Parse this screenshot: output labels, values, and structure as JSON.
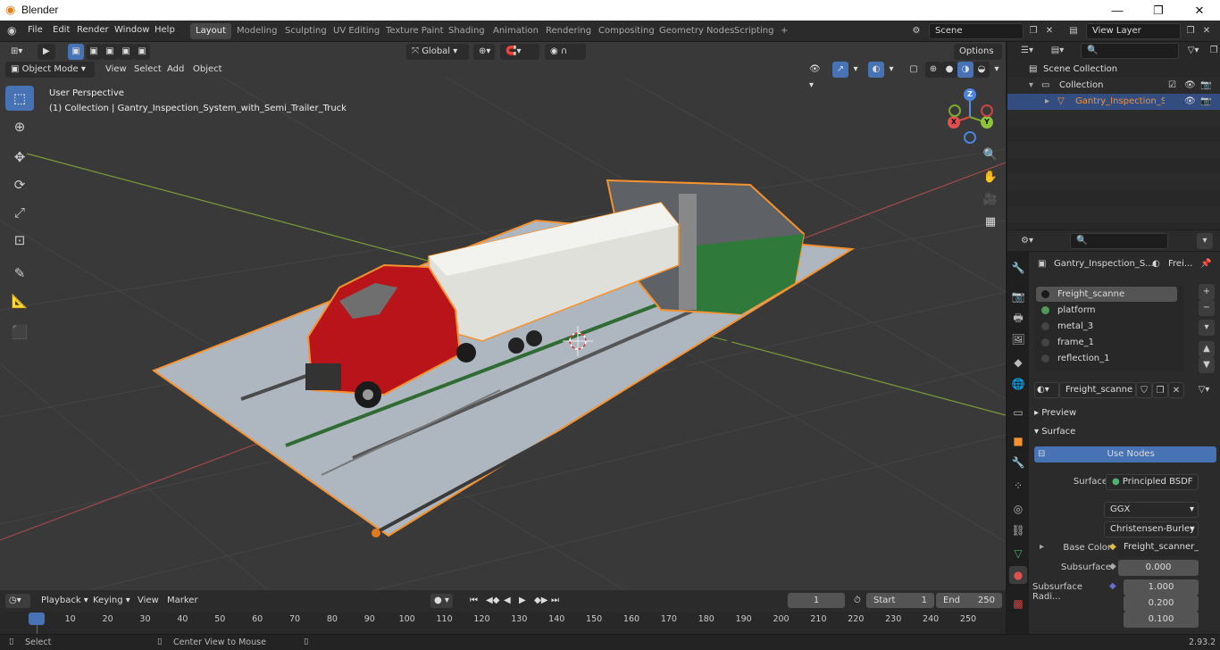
{
  "window": {
    "title": "Blender",
    "minimize": "—",
    "maximize": "❐",
    "close": "✕"
  },
  "menus": [
    "File",
    "Edit",
    "Render",
    "Window",
    "Help"
  ],
  "workspaces": [
    "Layout",
    "Modeling",
    "Sculpting",
    "UV Editing",
    "Texture Paint",
    "Shading",
    "Animation",
    "Rendering",
    "Compositing",
    "Geometry Nodes",
    "Scripting"
  ],
  "active_workspace": "Layout",
  "scene": {
    "name": "Scene",
    "view_layer": "View Layer"
  },
  "viewport": {
    "mode": "Object Mode",
    "menus": [
      "View",
      "Select",
      "Add",
      "Object"
    ],
    "orientation": "Global",
    "options": "Options",
    "perspective_label": "User Perspective",
    "collection_label": "(1) Collection | Gantry_Inspection_System_with_Semi_Trailer_Truck",
    "axes": {
      "x": "X",
      "y": "Y",
      "z": "Z"
    }
  },
  "outliner": {
    "root": "Scene Collection",
    "collection": "Collection",
    "object": "Gantry_Inspection_Syster"
  },
  "properties": {
    "object_name": "Gantry_Inspection_S...",
    "material_short": "Frei...",
    "slots": [
      {
        "name": "Freight_scanne",
        "color": "#1a1a1a"
      },
      {
        "name": "platform",
        "color": "#4f9a58"
      },
      {
        "name": "metal_3",
        "color": "#444444"
      },
      {
        "name": "frame_1",
        "color": "#444444"
      },
      {
        "name": "reflection_1",
        "color": "#444444"
      }
    ],
    "material_name": "Freight_scanne",
    "preview_label": "Preview",
    "surface_label": "Surface",
    "use_nodes": "Use Nodes",
    "surface_field_label": "Surface",
    "surface_shader": "Principled BSDF",
    "distribution": "GGX",
    "subsurface_method": "Christensen-Burley",
    "base_color_label": "Base Color",
    "base_color_value": "Freight_scanner_diff...",
    "subsurface_label": "Subsurface",
    "subsurface_value": "0.000",
    "subsurface_radius_label": "Subsurface Radi...",
    "subsurface_radius": [
      "1.000",
      "0.200",
      "0.100"
    ]
  },
  "timeline": {
    "menus": [
      "Playback",
      "Keying",
      "View",
      "Marker"
    ],
    "current_frame": "1",
    "start_label": "Start",
    "start": "1",
    "end_label": "End",
    "end": "250",
    "ticks": [
      "1",
      "10",
      "20",
      "30",
      "40",
      "50",
      "60",
      "70",
      "80",
      "90",
      "100",
      "110",
      "120",
      "130",
      "140",
      "150",
      "160",
      "170",
      "180",
      "190",
      "200",
      "210",
      "220",
      "230",
      "240",
      "250"
    ]
  },
  "statusbar": {
    "left": "Select",
    "middle": "Center View to Mouse",
    "version": "2.93.2"
  },
  "colors": {
    "accent": "#4772b3",
    "selection_outline": "#f5922f",
    "truck_red": "#b8141a"
  }
}
